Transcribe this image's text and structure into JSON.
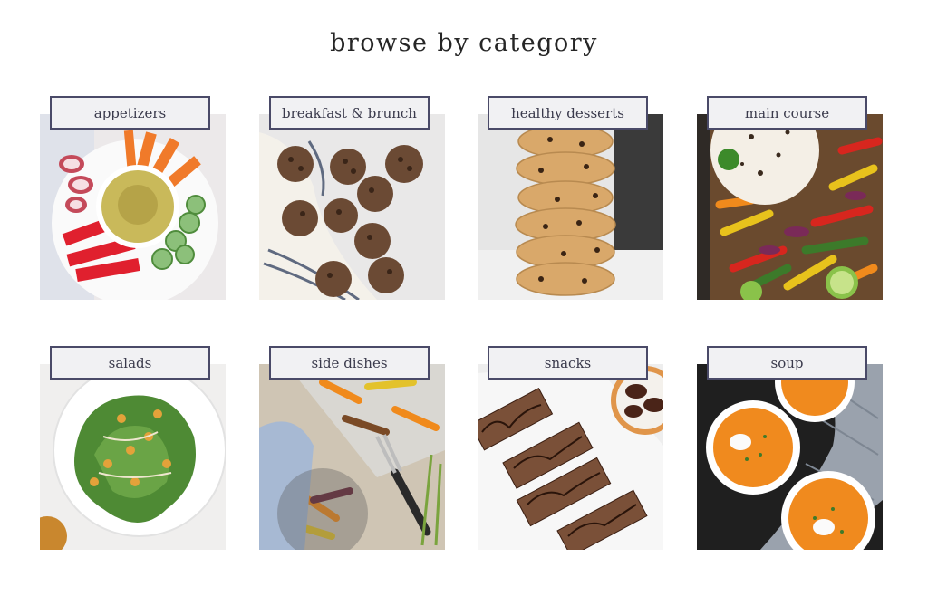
{
  "page": {
    "heading": "browse by category"
  },
  "categories": [
    {
      "label": "appetizers",
      "image": "hummus-vegetable-platter"
    },
    {
      "label": "breakfast & brunch",
      "image": "muffins"
    },
    {
      "label": "healthy desserts",
      "image": "stacked-cookies"
    },
    {
      "label": "main course",
      "image": "fajita-sheet-pan"
    },
    {
      "label": "salads",
      "image": "kale-chickpea-salad"
    },
    {
      "label": "side dishes",
      "image": "roasted-vegetables"
    },
    {
      "label": "snacks",
      "image": "chocolate-bars"
    },
    {
      "label": "soup",
      "image": "carrot-soup-bowls"
    }
  ],
  "colors": {
    "label_border": "#4a4a68",
    "label_bg": "#f1f1f3",
    "heading": "#262626"
  }
}
